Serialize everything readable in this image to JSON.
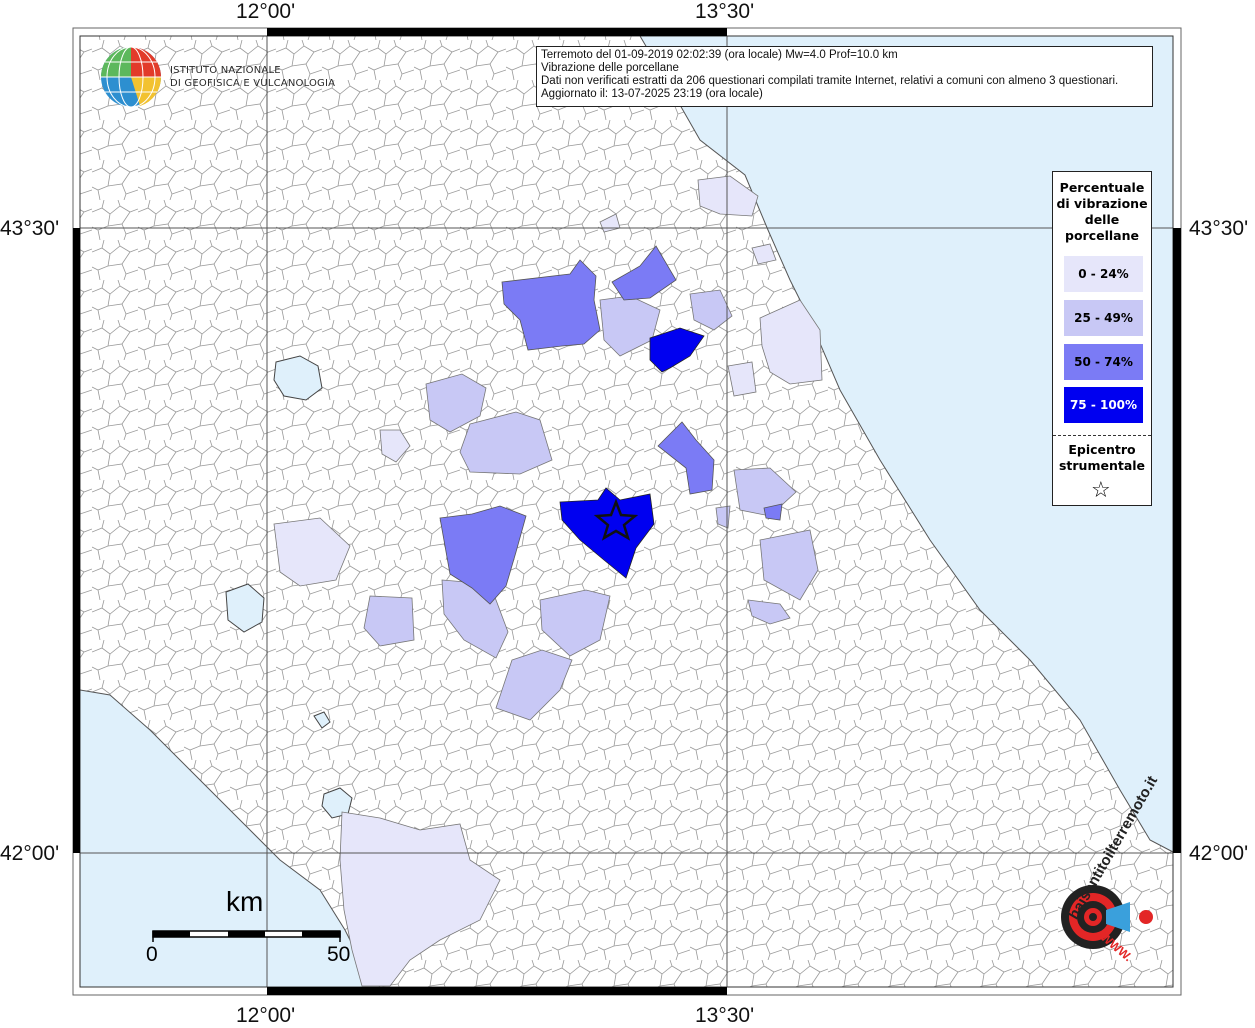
{
  "header": {
    "line1": "Terremoto del 01-09-2019 02:02:39 (ora locale) Mw=4.0 Prof=10.0 km",
    "line2": "Vibrazione delle porcellane",
    "line3": "Dati non verificati estratti da 206 questionari compilati tramite Internet, relativi a comuni con almeno 3 questionari.",
    "line4": "Aggiornato il: 13-07-2025 23:19 (ora locale)"
  },
  "logo": {
    "line1": "ISTITUTO NAZIONALE",
    "line2": "DI GEOFISICA E VULCANOLOGIA"
  },
  "axes": {
    "lon_left": "12°00'",
    "lon_right": "13°30'",
    "lat_top": "43°30'",
    "lat_bottom": "42°00'"
  },
  "legend": {
    "title_lines": [
      "Percentuale",
      "di vibrazione",
      "delle",
      "porcellane"
    ],
    "classes": [
      {
        "label": "0 - 24%",
        "color": "#e6e6fa"
      },
      {
        "label": "25 - 49%",
        "color": "#c8c8f5"
      },
      {
        "label": "50 - 74%",
        "color": "#7b7bf5"
      },
      {
        "label": "75 - 100%",
        "color": "#0000f0"
      }
    ],
    "epicenter_lines": [
      "Epicentro",
      "strumentale"
    ],
    "epicenter_symbol": "☆"
  },
  "scale_bar": {
    "unit": "km",
    "min_label": "0",
    "max_label": "50"
  },
  "brand": {
    "text": "haisentitoilterremoto.it",
    "www": "WWW."
  },
  "colors": {
    "sea": "#dff0fb",
    "land": "#ffffff",
    "borders": "#8a8a8a"
  }
}
